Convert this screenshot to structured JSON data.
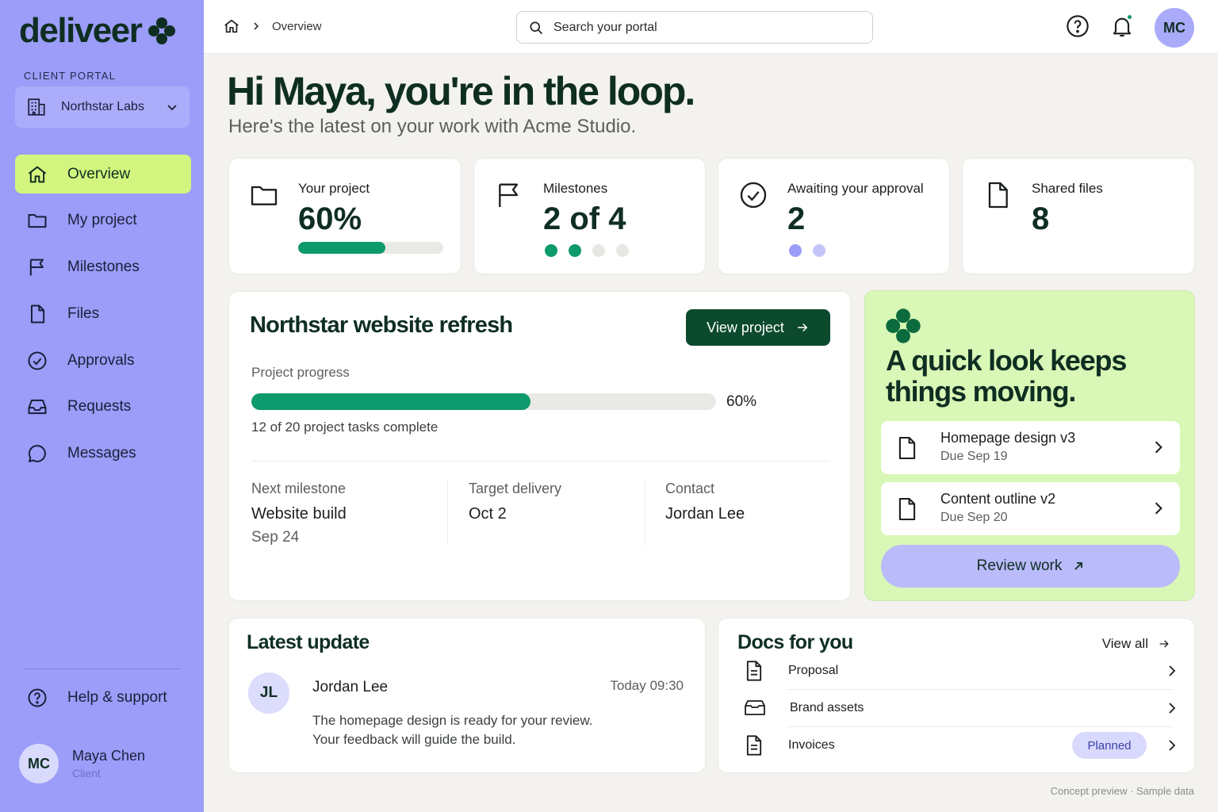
{
  "brand": {
    "name": "deliveer",
    "accent": "#d3f57f",
    "sidebar_color": "#9b9df8",
    "primary_green": "#0c4a2e",
    "progress_green": "#0d9a6c"
  },
  "sidebar": {
    "section_label": "CLIENT PORTAL",
    "org": {
      "name": "Northstar Labs",
      "icon": "building-icon"
    },
    "items": [
      {
        "label": "Overview",
        "icon": "home-icon",
        "active": true
      },
      {
        "label": "My project",
        "icon": "folder-icon",
        "active": false
      },
      {
        "label": "Milestones",
        "icon": "flag-icon",
        "active": false
      },
      {
        "label": "Files",
        "icon": "file-icon",
        "active": false
      },
      {
        "label": "Approvals",
        "icon": "check-circle-icon",
        "active": false
      },
      {
        "label": "Requests",
        "icon": "inbox-icon",
        "active": false
      },
      {
        "label": "Messages",
        "icon": "chat-icon",
        "active": false
      }
    ],
    "help_label": "Help & support",
    "user": {
      "initials": "MC",
      "name": "Maya Chen",
      "role": "Client"
    }
  },
  "topbar": {
    "breadcrumb": "Overview",
    "search_placeholder": "Search your portal",
    "avatar_initials": "MC"
  },
  "greeting": {
    "title": "Hi Maya, you're in the loop.",
    "subtitle": "Here's the latest on your work with Acme Studio."
  },
  "stats": {
    "project": {
      "label": "Your project",
      "value": "60%",
      "progress": 0.6
    },
    "milestones": {
      "label": "Milestones",
      "value": "2 of 4",
      "completed": 2,
      "total": 4
    },
    "approvals": {
      "label": "Awaiting your approval",
      "value": "2",
      "pending": 2
    },
    "files": {
      "label": "Shared files",
      "value": "8"
    }
  },
  "project": {
    "title": "Northstar website refresh",
    "view_button": "View project",
    "progress_label": "Project progress",
    "progress": 0.6,
    "progress_pct": "60%",
    "tasks_text": "12 of 20 project tasks complete",
    "next_milestone": {
      "label": "Next milestone",
      "value": "Website build",
      "date": "Sep 24"
    },
    "target_delivery": {
      "label": "Target delivery",
      "value": "Oct 2"
    },
    "contact": {
      "label": "Contact",
      "value": "Jordan Lee"
    }
  },
  "promo": {
    "title": "A quick look keeps things moving.",
    "tasks": [
      {
        "name": "Homepage design v3",
        "due": "Due Sep 19"
      },
      {
        "name": "Content outline v2",
        "due": "Due Sep 20"
      }
    ],
    "review_button": "Review work"
  },
  "update": {
    "title": "Latest update",
    "initials": "JL",
    "author": "Jordan Lee",
    "time": "Today 09:30",
    "line1": "The homepage design is ready for your review.",
    "line2": "Your feedback will guide the build."
  },
  "docs": {
    "title": "Docs for you",
    "view_all": "View all",
    "items": [
      {
        "name": "Proposal",
        "icon": "document-icon"
      },
      {
        "name": "Brand assets",
        "icon": "archive-icon"
      },
      {
        "name": "Invoices",
        "icon": "document-icon",
        "badge": "Planned"
      }
    ]
  },
  "footer_note": "Concept preview · Sample data"
}
